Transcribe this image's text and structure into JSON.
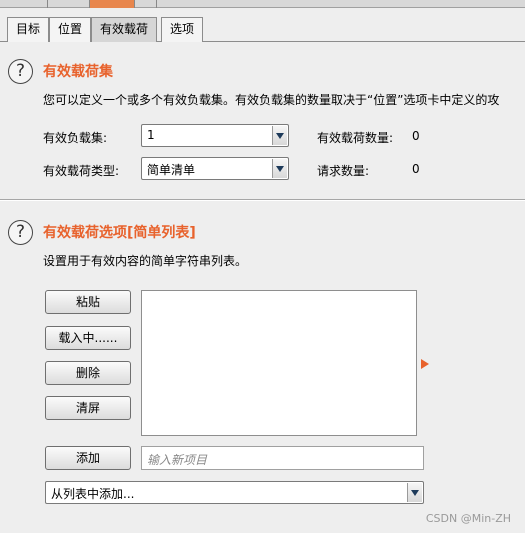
{
  "tabs": [
    "目标",
    "位置",
    "有效载荷",
    "选项"
  ],
  "active_tab": "有效载荷",
  "payload_sets": {
    "help_glyph": "?",
    "title": "有效载荷集",
    "description": "您可以定义一个或多个有效负载集。有效负载集的数量取决于“位置”选项卡中定义的攻",
    "set_label": "有效负载集:",
    "set_value": "1",
    "count_label": "有效载荷数量:",
    "count_value": "0",
    "type_label": "有效载荷类型:",
    "type_value": "简单清单",
    "request_label": "请求数量:",
    "request_value": "0"
  },
  "payload_options": {
    "help_glyph": "?",
    "title": "有效载荷选项[简单列表]",
    "description": "设置用于有效内容的简单字符串列表。",
    "buttons": {
      "paste": "粘贴",
      "load": "载入中......",
      "remove": "删除",
      "clear": "清屏",
      "add": "添加"
    },
    "new_item_placeholder": "输入新项目",
    "add_from_list": "从列表中添加..."
  },
  "watermark": "CSDN @Min-ZH",
  "colors": {
    "accent": "#e8622c",
    "active_strip": "#e8864d"
  },
  "icons": {
    "help": "question-circle-icon",
    "dropdown": "chevron-down-icon",
    "expand": "triangle-right-icon"
  }
}
